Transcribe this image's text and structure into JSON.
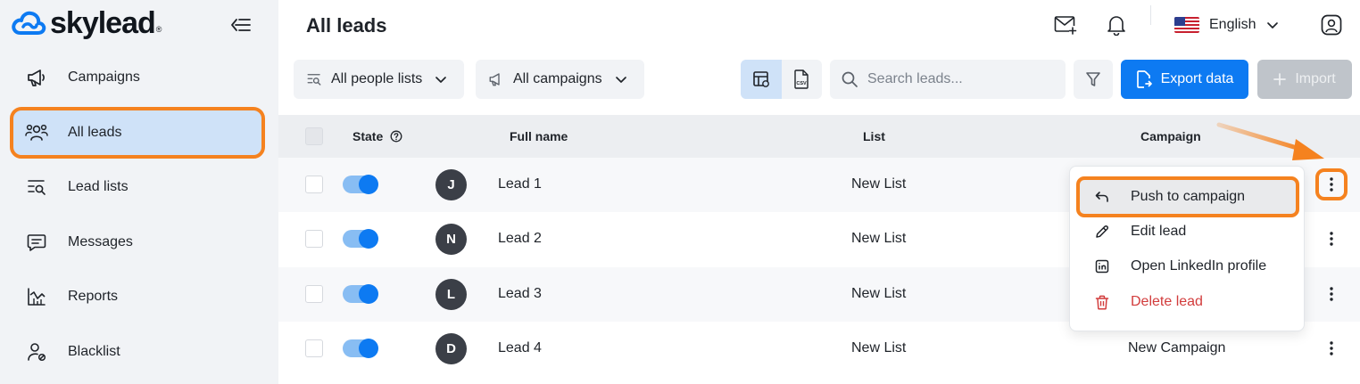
{
  "brand": {
    "name": "skylead",
    "reg": "®"
  },
  "sidebar": {
    "items": [
      {
        "label": "Campaigns",
        "icon": "megaphone-icon"
      },
      {
        "label": "All leads",
        "icon": "people-icon",
        "active": true
      },
      {
        "label": "Lead lists",
        "icon": "list-search-icon"
      },
      {
        "label": "Messages",
        "icon": "message-icon"
      },
      {
        "label": "Reports",
        "icon": "chart-icon"
      },
      {
        "label": "Blacklist",
        "icon": "user-block-icon"
      }
    ]
  },
  "header": {
    "title": "All leads",
    "language": "English"
  },
  "toolbar": {
    "people_lists": "All people lists",
    "campaigns": "All campaigns",
    "view_csv_label": "CSV",
    "search_placeholder": "Search leads...",
    "export_label": "Export data",
    "import_label": "Import"
  },
  "table": {
    "columns": {
      "state": "State",
      "full_name": "Full name",
      "list": "List",
      "campaign": "Campaign"
    },
    "rows": [
      {
        "initial": "J",
        "name": "Lead 1",
        "list": "New List",
        "campaign": ""
      },
      {
        "initial": "N",
        "name": "Lead 2",
        "list": "New List",
        "campaign": ""
      },
      {
        "initial": "L",
        "name": "Lead 3",
        "list": "New List",
        "campaign": ""
      },
      {
        "initial": "D",
        "name": "Lead 4",
        "list": "New List",
        "campaign": "New Campaign"
      }
    ]
  },
  "context_menu": {
    "items": [
      {
        "label": "Push to campaign",
        "icon": "reply-arrow-icon"
      },
      {
        "label": "Edit lead",
        "icon": "pencil-icon"
      },
      {
        "label": "Open LinkedIn profile",
        "icon": "linkedin-icon"
      },
      {
        "label": "Delete lead",
        "icon": "trash-icon"
      }
    ]
  },
  "colors": {
    "accent": "#0d7af2",
    "highlight": "#f5821f",
    "danger": "#d23c3c",
    "sidebar_bg": "#f1f3f6",
    "active_bg": "#cfe2f8"
  }
}
